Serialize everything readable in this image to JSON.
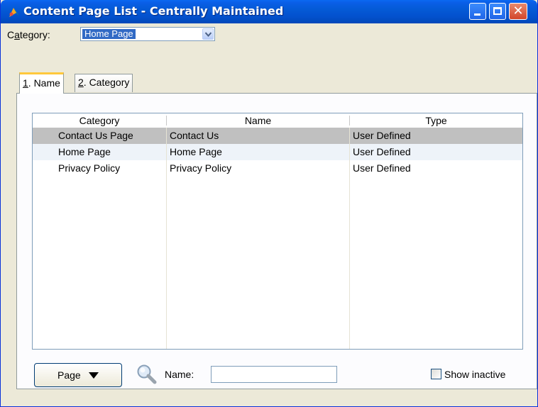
{
  "window": {
    "title": "Content Page List - Centrally Maintained",
    "controls": [
      "minimize",
      "maximize",
      "close"
    ],
    "close_glyph": "✕"
  },
  "category_filter": {
    "label_prefix": "C",
    "label_accel": "a",
    "label_suffix": "tegory:",
    "selected": "Home Page"
  },
  "tabs": [
    {
      "accel": "1",
      "label": ". Name",
      "active": true
    },
    {
      "accel": "2",
      "label": ". Category",
      "active": false
    }
  ],
  "grid": {
    "columns": [
      "Category",
      "Name",
      "Type"
    ],
    "rows": [
      {
        "category": "Contact Us Page",
        "name": "Contact Us",
        "type": "User Defined"
      },
      {
        "category": "Home Page",
        "name": "Home Page",
        "type": "User Defined"
      },
      {
        "category": "Privacy Policy",
        "name": "Privacy Policy",
        "type": "User Defined"
      }
    ]
  },
  "footer": {
    "page_button": "Page",
    "name_label": "Name:",
    "name_value": "",
    "show_inactive_label": "Show inactive",
    "show_inactive_checked": false
  },
  "colors": {
    "titlebar": "#0351ce",
    "selected_row": "#c0c0c0",
    "active_tab_accent": "#ffc83c"
  }
}
